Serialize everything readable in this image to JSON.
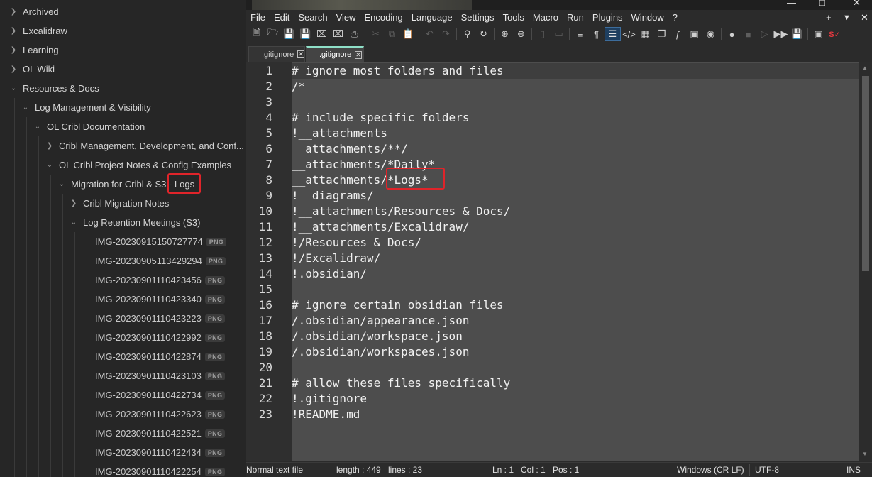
{
  "file_tree": {
    "folders": [
      {
        "label": "Archived"
      },
      {
        "label": "Excalidraw"
      },
      {
        "label": "Learning"
      },
      {
        "label": "OL Wiki"
      },
      {
        "label": "Resources & Docs"
      },
      {
        "label": "Log Management & Visibility"
      },
      {
        "label": "OL Cribl Documentation"
      },
      {
        "label": "Cribl Management, Development, and Conf..."
      },
      {
        "label": "OL Cribl Project Notes & Config Examples"
      },
      {
        "label": "Migration for Cribl & S3 - Logs"
      },
      {
        "label": "Cribl Migration Notes"
      },
      {
        "label": "Log Retention Meetings (S3)"
      }
    ],
    "files": [
      {
        "name": "IMG-20230915150727774",
        "ext": "PNG"
      },
      {
        "name": "IMG-20230905113429294",
        "ext": "PNG"
      },
      {
        "name": "IMG-20230901110423456",
        "ext": "PNG"
      },
      {
        "name": "IMG-20230901110423340",
        "ext": "PNG"
      },
      {
        "name": "IMG-20230901110423223",
        "ext": "PNG"
      },
      {
        "name": "IMG-20230901110422992",
        "ext": "PNG"
      },
      {
        "name": "IMG-20230901110422874",
        "ext": "PNG"
      },
      {
        "name": "IMG-20230901110423103",
        "ext": "PNG"
      },
      {
        "name": "IMG-20230901110422734",
        "ext": "PNG"
      },
      {
        "name": "IMG-20230901110422623",
        "ext": "PNG"
      },
      {
        "name": "IMG-20230901110422521",
        "ext": "PNG"
      },
      {
        "name": "IMG-20230901110422434",
        "ext": "PNG"
      },
      {
        "name": "IMG-20230901110422254",
        "ext": "PNG"
      }
    ]
  },
  "editor": {
    "menu": [
      "File",
      "Edit",
      "Search",
      "View",
      "Encoding",
      "Language",
      "Settings",
      "Tools",
      "Macro",
      "Run",
      "Plugins",
      "Window",
      "?"
    ],
    "menu_extras": {
      "plus": "+",
      "dropdown": "▼",
      "close": "✕"
    },
    "tabs": [
      {
        "label": ".gitignore",
        "active": false
      },
      {
        "label": ".gitignore",
        "active": true
      }
    ],
    "lines": [
      "# ignore most folders and files",
      "/*",
      "",
      "# include specific folders",
      "!__attachments",
      "__attachments/**/",
      "__attachments/*Daily*",
      "__attachments/*Logs*",
      "!__diagrams/",
      "!__attachments/Resources & Docs/",
      "!__attachments/Excalidraw/",
      "!/Resources & Docs/",
      "!/Excalidraw/",
      "!.obsidian/",
      "",
      "# ignore certain obsidian files",
      "/.obsidian/appearance.json",
      "/.obsidian/workspace.json",
      "/.obsidian/workspaces.json",
      "",
      "# allow these files specifically",
      "!.gitignore",
      "!README.md"
    ],
    "line_numbers": [
      "1",
      "2",
      "3",
      "4",
      "5",
      "6",
      "7",
      "8",
      "9",
      "10",
      "11",
      "12",
      "13",
      "14",
      "15",
      "16",
      "17",
      "18",
      "19",
      "20",
      "21",
      "22",
      "23"
    ]
  },
  "status_bar": {
    "file_type": "Normal text file",
    "length": "length : 449",
    "lines": "lines : 23",
    "ln": "Ln : 1",
    "col": "Col : 1",
    "pos": "Pos : 1",
    "eol": "Windows (CR LF)",
    "encoding": "UTF-8",
    "mode": "INS"
  },
  "highlight_color": "#e0242a"
}
